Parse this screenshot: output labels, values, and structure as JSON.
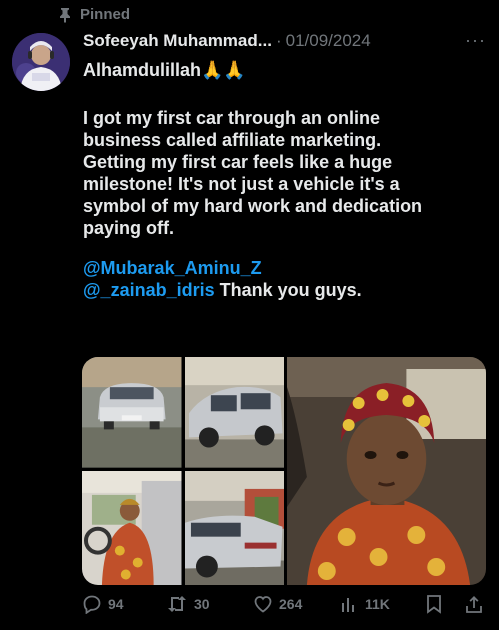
{
  "pinned": {
    "label": "Pinned"
  },
  "post": {
    "author_name": "Sofeeyah Muhammad...",
    "separator": "·",
    "date": "01/09/2024",
    "more": "···",
    "line1": "Alhamdulillah🙏🙏",
    "body": "I got my first car through an online\nbusiness called affiliate marketing.\nGetting my first car feels like a huge\nmilestone! It's not just a vehicle it's a\nsymbol of my hard work and dedication\npaying off.",
    "mention1": "@Mubarak_Aminu_Z",
    "mention2": "@_zainab_idris",
    "mention2_suffix": " Thank you guys."
  },
  "media": {
    "images": [
      "car-front",
      "car-side",
      "woman-in-car",
      "car-rear",
      "selfie"
    ]
  },
  "actions": {
    "replies": "94",
    "reposts": "30",
    "likes": "264",
    "views": "11K"
  },
  "colors": {
    "accent": "#1d9bf0",
    "muted": "#71767b",
    "text": "#e7e9ea",
    "background": "#000000"
  }
}
